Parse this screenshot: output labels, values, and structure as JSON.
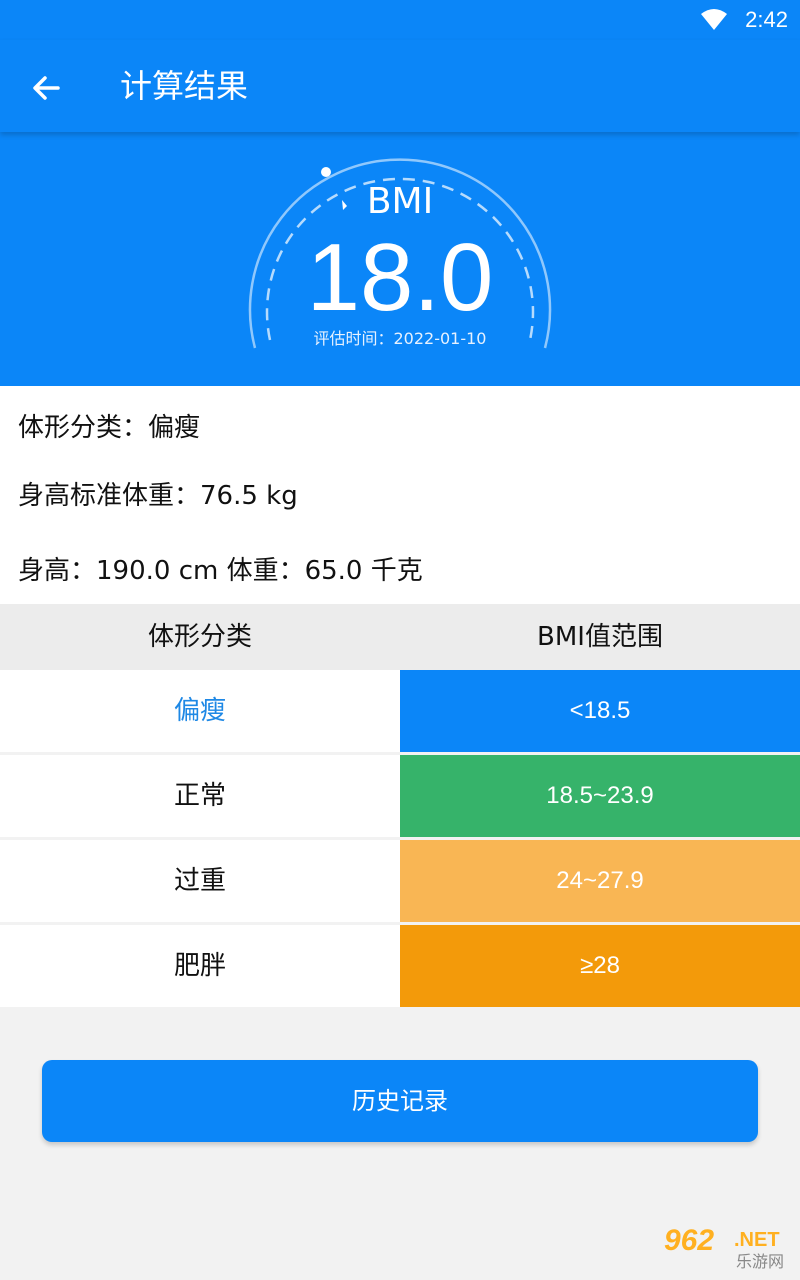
{
  "status_bar": {
    "time": "2:42",
    "wifi_icon": "wifi-icon"
  },
  "toolbar": {
    "back_icon": "arrow-left-icon",
    "title": "计算结果"
  },
  "result": {
    "label": "BMI",
    "value": "18.0",
    "eval_date": "评估时间：2022-01-10"
  },
  "info": {
    "body_type": "体形分类：偏瘦",
    "standard_weight": "身高标准体重：76.5 kg",
    "height_weight": "身高：190.0 cm  体重：65.0 千克"
  },
  "table": {
    "headers": [
      "体形分类",
      "BMI值范围"
    ],
    "rows": [
      {
        "category": "偏瘦",
        "range": "<18.5",
        "color": "#0b86f8",
        "text_color": "#1e88e5"
      },
      {
        "category": "正常",
        "range": "18.5~23.9",
        "color": "#36b36a",
        "text_color": "#111111"
      },
      {
        "category": "过重",
        "range": "24~27.9",
        "color": "#f9b654",
        "text_color": "#111111"
      },
      {
        "category": "肥胖",
        "range": "≥28",
        "color": "#f39a0a",
        "text_color": "#111111"
      }
    ]
  },
  "history_button": {
    "label": "历史记录"
  },
  "watermark": {
    "number": "962",
    "suffix": ".NET",
    "sub": "乐游网"
  },
  "colors": {
    "primary": "#0b86f8",
    "background": "#f2f2f2"
  }
}
